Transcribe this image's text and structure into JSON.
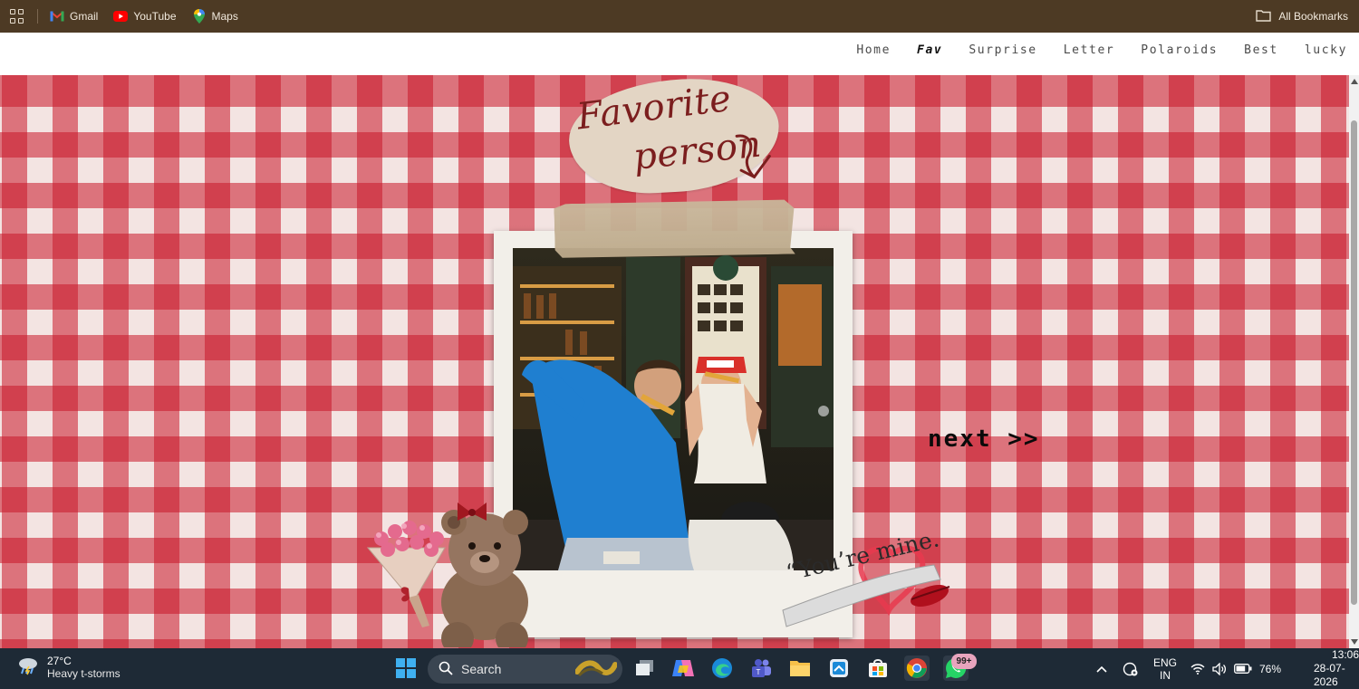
{
  "bookmarks_bar": {
    "items": [
      {
        "label": "Gmail",
        "icon": "gmail-icon"
      },
      {
        "label": "YouTube",
        "icon": "youtube-icon"
      },
      {
        "label": "Maps",
        "icon": "maps-icon"
      }
    ],
    "all_bookmarks": "All Bookmarks"
  },
  "site_nav": {
    "links": [
      "Home",
      "Fav",
      "Surprise",
      "Letter",
      "Polaroids",
      "Best",
      "lucky"
    ],
    "active": "Fav"
  },
  "page": {
    "title_line1": "Favorite",
    "title_line2": "person",
    "next_label": "next >>",
    "quote": "“You’re mine.",
    "colors": {
      "gingham_red": "#c81628",
      "gingham_light": "#f3e4e2",
      "title_ink": "#7b1e1e",
      "polaroid": "#f2efe9"
    }
  },
  "taskbar": {
    "weather_temp": "27°C",
    "weather_desc": "Heavy t-storms",
    "search_label": "Search",
    "apps": [
      "start-icon",
      "task-view-icon",
      "copilot-icon",
      "edge-icon",
      "teams-icon",
      "file-explorer-icon",
      "snipping-tool-icon",
      "store-icon",
      "chrome-icon",
      "whatsapp-icon"
    ],
    "whatsapp_badge": "99+",
    "lang_line1": "ENG",
    "lang_line2": "IN",
    "battery": "76%",
    "time": "13:06",
    "date": "28-07-2026"
  }
}
